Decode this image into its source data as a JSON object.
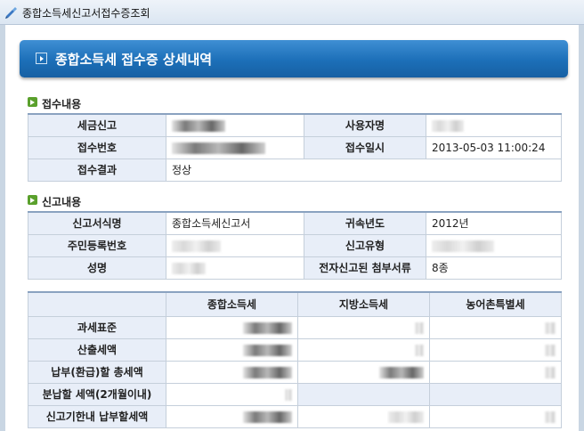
{
  "window": {
    "title": "종합소득세신고서접수증조회"
  },
  "header": {
    "title": "종합소득세 접수증 상세내역"
  },
  "receipt": {
    "section_title": "접수내용",
    "tax_report_label": "세금신고",
    "user_name_label": "사용자명",
    "receipt_no_label": "접수번호",
    "receipt_datetime_label": "접수일시",
    "receipt_datetime": "2013-05-03 11:00:24",
    "result_label": "접수결과",
    "result": "정상"
  },
  "report": {
    "section_title": "신고내용",
    "form_name_label": "신고서식명",
    "form_name": "종합소득세신고서",
    "year_label": "귀속년도",
    "year": "2012년",
    "resident_no_label": "주민등록번호",
    "report_type_label": "신고유형",
    "name_label": "성명",
    "attachments_label": "전자신고된 첨부서류",
    "attachments": "8종"
  },
  "amounts": {
    "columns": [
      "종합소득세",
      "지방소득세",
      "농어촌특별세"
    ],
    "rows": [
      {
        "label": "과세표준"
      },
      {
        "label": "산출세액"
      },
      {
        "label": "납부(환급)할 총세액"
      },
      {
        "label": "분납할 세액(2개월이내)"
      },
      {
        "label": "신고기한내 납부할세액"
      }
    ]
  }
}
